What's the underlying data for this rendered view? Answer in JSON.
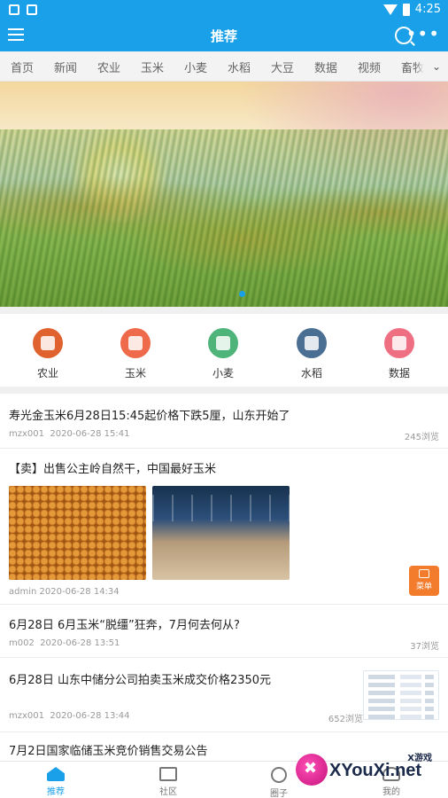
{
  "status": {
    "time": "4:25"
  },
  "header": {
    "title": "推荐"
  },
  "tabs": [
    "首页",
    "新闻",
    "农业",
    "玉米",
    "小麦",
    "水稻",
    "大豆",
    "数据",
    "视频",
    "畜牧"
  ],
  "categories": [
    {
      "label": "农业",
      "color": "#e0632f"
    },
    {
      "label": "玉米",
      "color": "#ef6a4a"
    },
    {
      "label": "小麦",
      "color": "#4fb47a"
    },
    {
      "label": "水稻",
      "color": "#4a6f93"
    },
    {
      "label": "数据",
      "color": "#ef6f82"
    }
  ],
  "feed": [
    {
      "title": "寿光金玉米6月28日15:45起价格下跌5厘，山东开始了",
      "author": "mzx001",
      "time": "2020-06-28 15:41",
      "views": "245浏览"
    },
    {
      "title": "【卖】出售公主岭自然干，中国最好玉米",
      "author": "admin",
      "time": "2020-06-28 14:34",
      "views": ""
    },
    {
      "title": "6月28日 6月玉米“脱缰”狂奔，7月何去何从?",
      "author": "m002",
      "time": "2020-06-28 13:51",
      "views": "37浏览"
    },
    {
      "title": "6月28日 山东中储分公司拍卖玉米成交价格2350元",
      "author": "mzx001",
      "time": "2020-06-28 13:44",
      "views": "652浏览"
    },
    {
      "title": "7月2日国家临储玉米竞价销售交易公告",
      "author": "",
      "time": "",
      "views": ""
    }
  ],
  "float_button": {
    "label": "菜单"
  },
  "bottom_nav": [
    "推荐",
    "社区",
    "圈子",
    "我的"
  ],
  "watermark": {
    "main": "XYouXi.net",
    "sub": "X游戏"
  }
}
